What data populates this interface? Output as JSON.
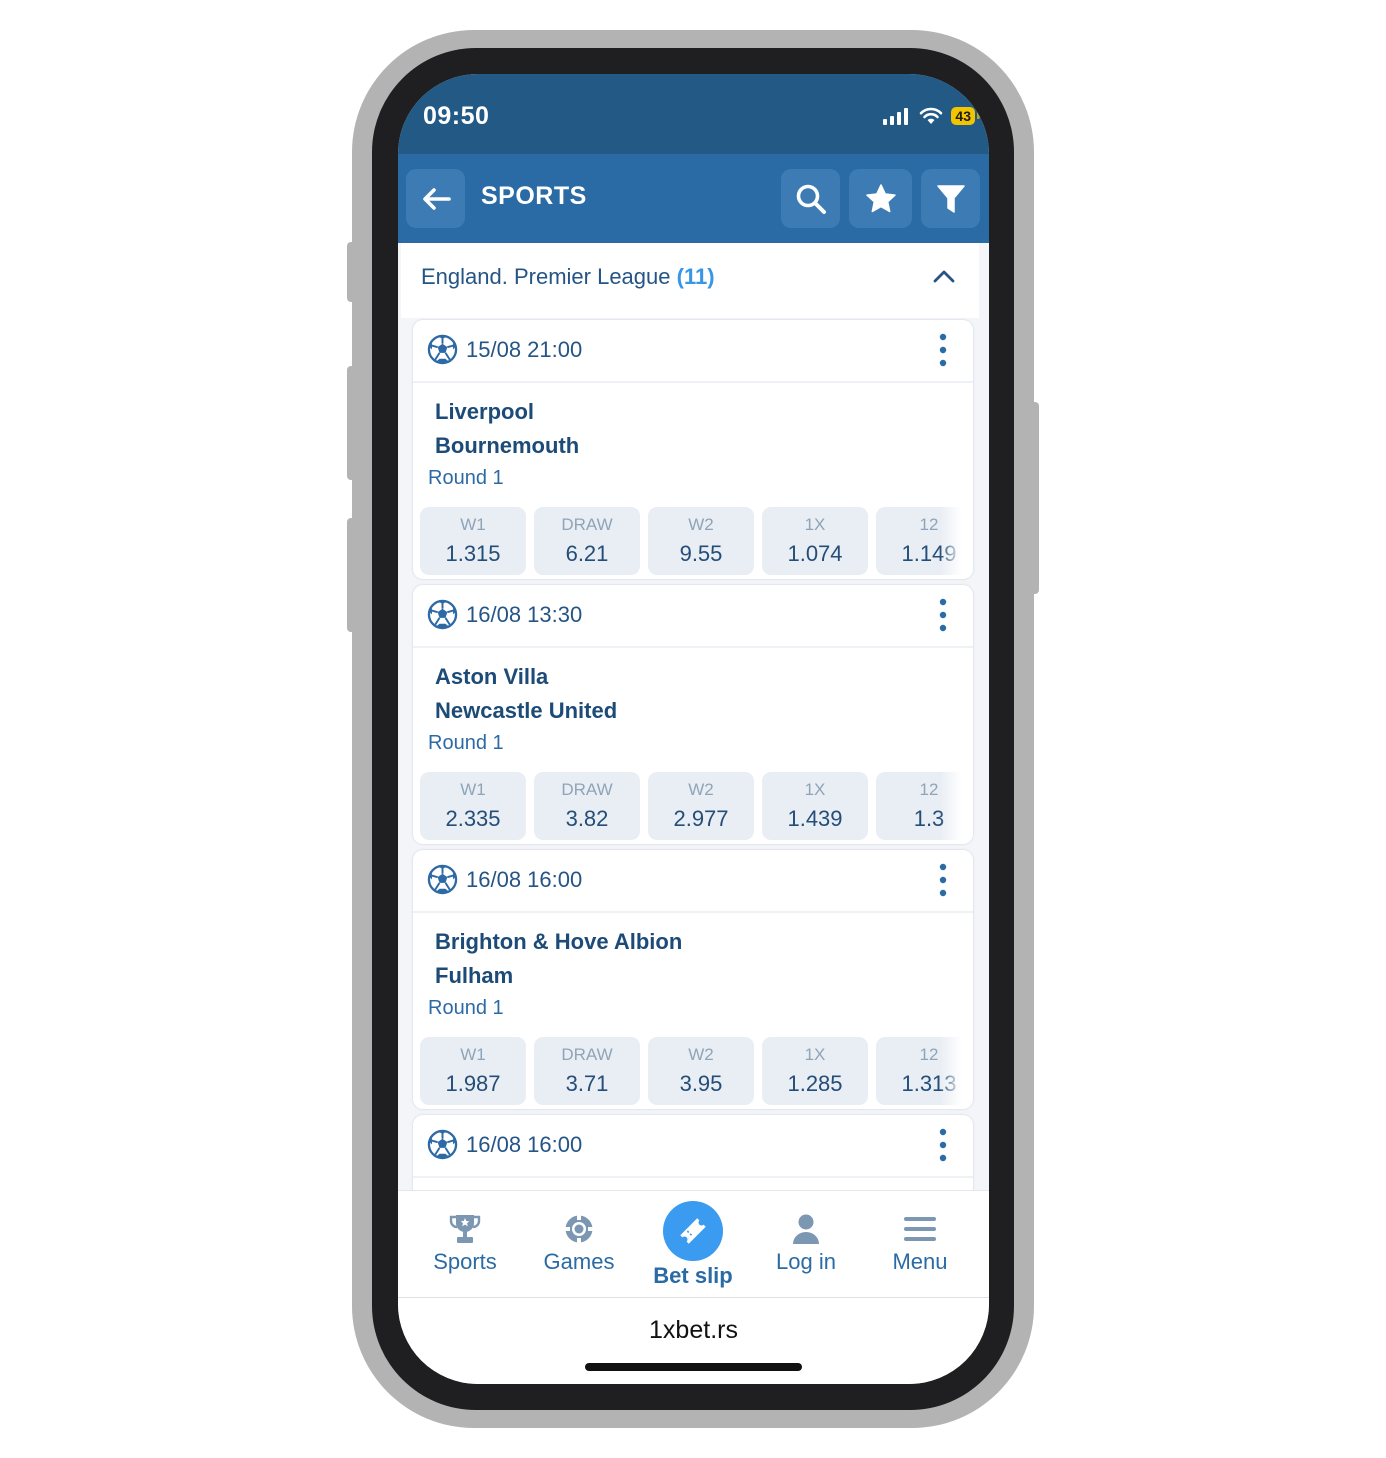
{
  "status": {
    "time": "09:50",
    "battery": "43"
  },
  "header": {
    "title": "SPORTS",
    "back_icon": "arrow-left-icon",
    "actions": [
      "search-icon",
      "star-icon",
      "filter-icon"
    ]
  },
  "league": {
    "name": "England. Premier League",
    "count": "(11)"
  },
  "matches": [
    {
      "datetime": "15/08 21:00",
      "team1": "Liverpool",
      "team2": "Bournemouth",
      "round": "Round 1",
      "odds": [
        {
          "label": "W1",
          "value": "1.315"
        },
        {
          "label": "DRAW",
          "value": "6.21"
        },
        {
          "label": "W2",
          "value": "9.55"
        },
        {
          "label": "1X",
          "value": "1.074"
        },
        {
          "label": "12",
          "value": "1.149"
        }
      ]
    },
    {
      "datetime": "16/08 13:30",
      "team1": "Aston Villa",
      "team2": "Newcastle United",
      "round": "Round 1",
      "odds": [
        {
          "label": "W1",
          "value": "2.335"
        },
        {
          "label": "DRAW",
          "value": "3.82"
        },
        {
          "label": "W2",
          "value": "2.977"
        },
        {
          "label": "1X",
          "value": "1.439"
        },
        {
          "label": "12",
          "value": "1.3"
        }
      ]
    },
    {
      "datetime": "16/08 16:00",
      "team1": "Brighton & Hove Albion",
      "team2": "Fulham",
      "round": "Round 1",
      "odds": [
        {
          "label": "W1",
          "value": "1.987"
        },
        {
          "label": "DRAW",
          "value": "3.71"
        },
        {
          "label": "W2",
          "value": "3.95"
        },
        {
          "label": "1X",
          "value": "1.285"
        },
        {
          "label": "12",
          "value": "1.313"
        }
      ]
    },
    {
      "datetime": "16/08 16:00"
    }
  ],
  "tabbar": {
    "items": [
      {
        "label": "Sports",
        "icon": "trophy-icon"
      },
      {
        "label": "Games",
        "icon": "chip-icon"
      },
      {
        "label": "Bet slip",
        "icon": "ticket-icon"
      },
      {
        "label": "Log in",
        "icon": "user-icon"
      },
      {
        "label": "Menu",
        "icon": "menu-icon"
      }
    ]
  },
  "browser": {
    "url": "1xbet.rs"
  },
  "colors": {
    "header": "#2b6ba5",
    "status": "#225985",
    "accent": "#3b9bf0",
    "text": "#1d4b78"
  }
}
